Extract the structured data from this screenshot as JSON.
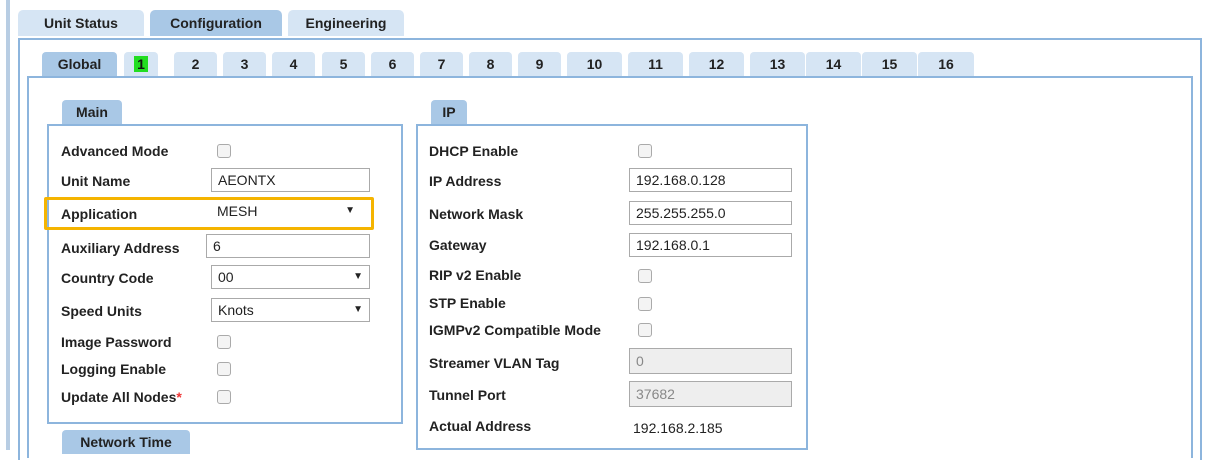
{
  "top_tabs": [
    "Unit Status",
    "Configuration",
    "Engineering"
  ],
  "sub_tabs": [
    "Global",
    "1",
    "2",
    "3",
    "4",
    "5",
    "6",
    "7",
    "8",
    "9",
    "10",
    "11",
    "12",
    "13",
    "14",
    "15",
    "16"
  ],
  "main": {
    "title": "Main",
    "advanced_mode": "Advanced Mode",
    "unit_name_label": "Unit Name",
    "unit_name_value": "AEONTX",
    "application_label": "Application",
    "application_value": "MESH",
    "aux_address_label": "Auxiliary Address",
    "aux_address_value": "6",
    "country_code_label": "Country Code",
    "country_code_value": "00",
    "speed_units_label": "Speed Units",
    "speed_units_value": "Knots",
    "image_password_label": "Image Password",
    "logging_enable_label": "Logging Enable",
    "update_all_nodes_label": "Update All Nodes",
    "update_all_nodes_required": "*"
  },
  "ip": {
    "title": "IP",
    "dhcp_enable_label": "DHCP Enable",
    "ip_address_label": "IP Address",
    "ip_address_value": "192.168.0.128",
    "network_mask_label": "Network Mask",
    "network_mask_value": "255.255.255.0",
    "gateway_label": "Gateway",
    "gateway_value": "192.168.0.1",
    "rip_label": "RIP v2 Enable",
    "stp_label": "STP Enable",
    "igmp_label": "IGMPv2 Compatible Mode",
    "streamer_vlan_label": "Streamer VLAN Tag",
    "streamer_vlan_value": "0",
    "tunnel_port_label": "Tunnel Port",
    "tunnel_port_value": "37682",
    "actual_address_label": "Actual Address",
    "actual_address_value": "192.168.2.185"
  },
  "network_time": {
    "title": "Network Time"
  },
  "colors": {
    "accent": "#8db5dd",
    "tab_active": "#a9c8e6",
    "highlight": "#f5b400",
    "green_badge": "#22dd22"
  }
}
